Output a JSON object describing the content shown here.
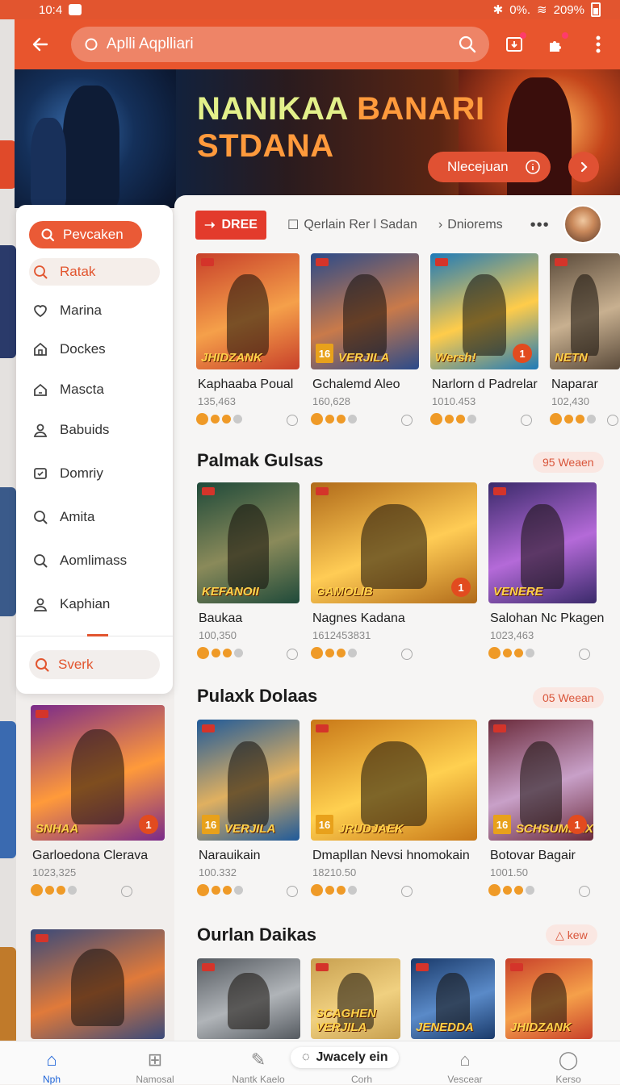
{
  "status_bar": {
    "time": "10:4",
    "battery": "0%.",
    "signal": "209%"
  },
  "search": {
    "placeholder": "Aplli Aqplliari"
  },
  "banner": {
    "title_part1": "NANIKAA ",
    "title_part2": "BANARI",
    "title_line2": "STDANA",
    "cta_label": "Nlecejuan"
  },
  "drawer": {
    "top_button": "Pevcaken",
    "items": [
      {
        "label": "Ratak",
        "icon": "search-icon",
        "active": true
      },
      {
        "label": "Marina",
        "icon": "heart-icon"
      },
      {
        "label": "Dockes",
        "icon": "home-icon"
      },
      {
        "label": "Mascta",
        "icon": "house-icon"
      },
      {
        "label": "Babuids",
        "icon": "user-icon"
      },
      {
        "label": "Domriy",
        "icon": "window-icon"
      },
      {
        "label": "Amita",
        "icon": "search-icon"
      },
      {
        "label": "Aomlimass",
        "icon": "search-icon"
      },
      {
        "label": "Kaphian",
        "icon": "user-icon"
      }
    ],
    "bottom_button": "Sverk"
  },
  "tabs": {
    "primary": "DREE",
    "tab2": "Qerlain Rer l Sadan",
    "tab3": "Dniorems",
    "more": "•••"
  },
  "row1": [
    {
      "title": "Kaphaaba Poual",
      "sub": "135,463",
      "art": "JHIDZANK",
      "colors": [
        "#c8402a",
        "#f5a04a"
      ]
    },
    {
      "title": "Gchalemd Aleo",
      "sub": "160,628",
      "art": "VERJILA",
      "colors": [
        "#2a4a8a",
        "#c97a4a"
      ]
    },
    {
      "title": "Narlorn d Padrelar",
      "sub": "1010.453",
      "art": "Wersh!",
      "colors": [
        "#1e7ab8",
        "#ffcc4a"
      ]
    },
    {
      "title": "Naparar",
      "sub": "102,430",
      "art": "NETN",
      "colors": [
        "#5a4a3a",
        "#c8b090"
      ]
    }
  ],
  "section2": {
    "title": "Palmak Gulsas",
    "pill": "95 Weaen"
  },
  "row2": [
    {
      "title": "Baukaa",
      "sub": "100,350",
      "art": "KEFANOII",
      "colors": [
        "#1f4a3a",
        "#8a8a5a"
      ]
    },
    {
      "title": "Nagnes Kadana",
      "sub": "1612453831",
      "art": "GAMOLIB",
      "colors": [
        "#b06a1a",
        "#ffcc55"
      ]
    },
    {
      "title": "Salohan Nc Pkagen",
      "sub": "1023,463",
      "art": "VENERE",
      "colors": [
        "#3a2a6a",
        "#b46ad8"
      ]
    }
  ],
  "section3": {
    "title": "Pulaxk Dolaas",
    "pill": "05 Weean"
  },
  "row3": [
    {
      "title": "Narauikain",
      "sub": "100.332",
      "art": "VERJILA",
      "colors": [
        "#1f5a9a",
        "#e0b060"
      ]
    },
    {
      "title": "Dmapllan Nevsi hnomokain",
      "sub": "18210.50",
      "art": "JRUDJAEK",
      "colors": [
        "#c87818",
        "#ffd050"
      ]
    },
    {
      "title": "Botovar Bagair",
      "sub": "1001.50",
      "art": "SCHSUMEAX",
      "colors": [
        "#6a2a3a",
        "#c8a0c8"
      ]
    }
  ],
  "left_card": {
    "title": "Garloedona Clerava",
    "sub": "1023,325",
    "art": "SNHAA",
    "colors": [
      "#7a2a8a",
      "#ff9a3a"
    ]
  },
  "section4": {
    "title": "Ourlan Daikas",
    "pill": "kew"
  },
  "row4": [
    {
      "art": "",
      "colors": [
        "#555a60",
        "#b0b4b8"
      ]
    },
    {
      "art": "SCAGHEN VERJILA",
      "colors": [
        "#c8a050",
        "#f0d080"
      ]
    },
    {
      "art": "JENEDDA",
      "colors": [
        "#1a3a6a",
        "#5a8ac8"
      ]
    },
    {
      "art": "JHIDZANK",
      "colors": [
        "#c8402a",
        "#f5a04a"
      ]
    }
  ],
  "bottom_nav": {
    "items": [
      "Nph",
      "Namosal",
      "Nantk Kaelo",
      "Corh",
      "Vescear",
      "Kerso"
    ],
    "center_pill": "Jwacely ein"
  }
}
